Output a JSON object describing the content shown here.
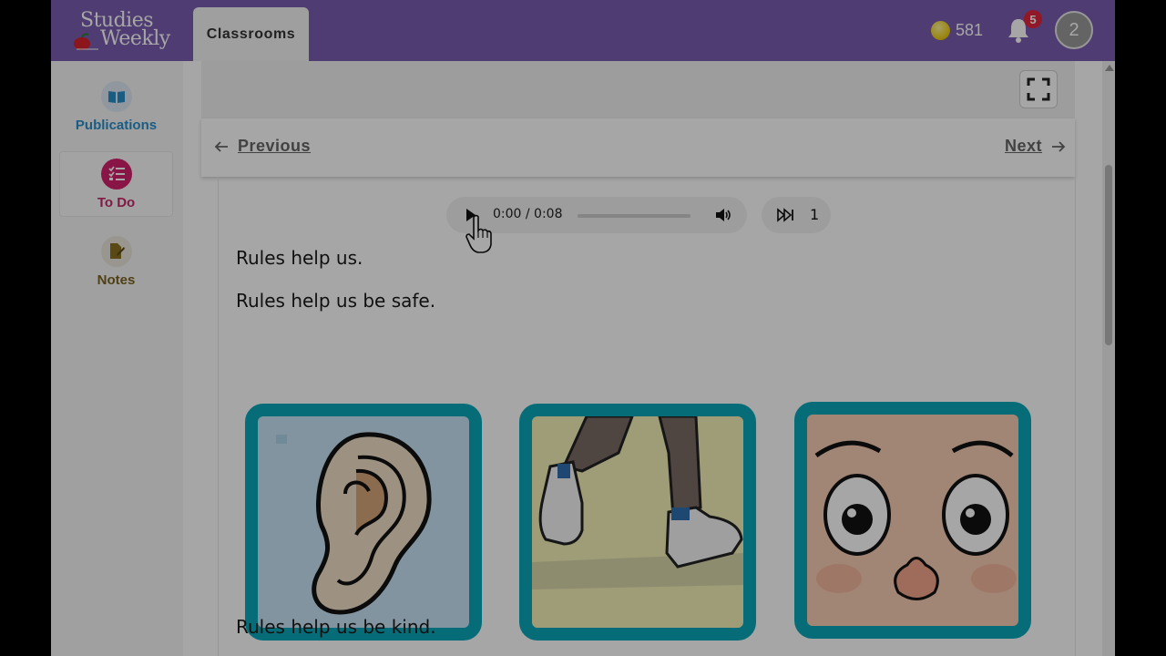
{
  "header": {
    "logo_line1": "Studies",
    "logo_line2": "Weekly",
    "tab_label": "Classrooms",
    "coins": "581",
    "notification_count": "5",
    "avatar_initial": "2"
  },
  "sidebar": {
    "items": [
      {
        "label": "Publications",
        "icon": "book-icon"
      },
      {
        "label": "To Do",
        "icon": "checklist-icon"
      },
      {
        "label": "Notes",
        "icon": "note-pencil-icon"
      }
    ]
  },
  "nav": {
    "previous_label": "Previous",
    "next_label": "Next"
  },
  "audio_player": {
    "time": "0:00 / 0:08",
    "progress": 0.0,
    "speed": "1"
  },
  "article": {
    "paragraphs": [
      "Rules help us.",
      "Rules help us be safe.",
      "Rules help us be kind."
    ],
    "images": [
      "ear",
      "walking feet",
      "eyes and nose"
    ]
  },
  "colors": {
    "header": "#7a5cb0",
    "card_border": "#0aa8b8",
    "todo_accent": "#d2216b",
    "publications_accent": "#2a8fc8"
  }
}
